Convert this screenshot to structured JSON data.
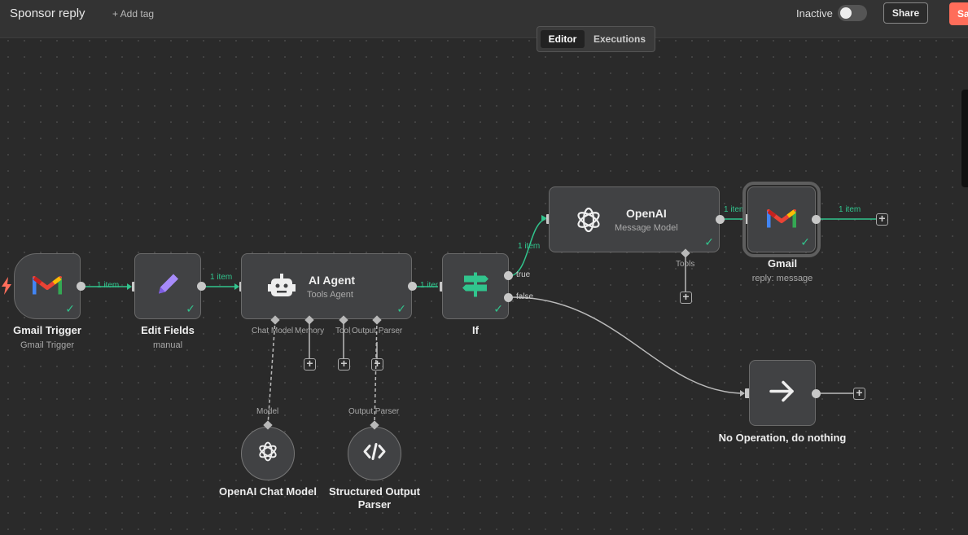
{
  "header": {
    "workflow_name": "Sponsor reply",
    "add_tag": "+ Add tag",
    "status_label": "Inactive",
    "share_label": "Share",
    "save_label": "Sa"
  },
  "view_tabs": [
    {
      "label": "Editor",
      "active": true
    },
    {
      "label": "Executions",
      "active": false
    }
  ],
  "nodes": {
    "gmail_trigger": {
      "title": "Gmail Trigger",
      "subtitle": "Gmail Trigger"
    },
    "edit_fields": {
      "title": "Edit Fields",
      "subtitle": "manual"
    },
    "ai_agent": {
      "title": "AI Agent",
      "subtitle": "Tools Agent",
      "ports": [
        "Chat Model",
        "Memory",
        "Tool",
        "Output Parser"
      ]
    },
    "if": {
      "title": "If",
      "true_label": "true",
      "false_label": "false"
    },
    "openai": {
      "title": "OpenAI",
      "subtitle": "Message Model",
      "tools_label": "Tools"
    },
    "gmail": {
      "title": "Gmail",
      "subtitle": "reply: message"
    },
    "no_op": {
      "title": "No Operation, do nothing"
    },
    "openai_chat_model": {
      "title": "OpenAI Chat Model",
      "port_label": "Model"
    },
    "structured_output_parser": {
      "title": "Structured Output Parser",
      "port_label": "Output Parser"
    }
  },
  "connections": {
    "trigger_to_edit": "1 item",
    "edit_to_agent": "1 item",
    "agent_to_if": "1 item",
    "if_to_openai": "1 item",
    "openai_to_gmail": "1 item",
    "gmail_out": "1 item"
  },
  "colors": {
    "canvas": "#2a2a2a",
    "node": "#414244",
    "success": "#31c48d",
    "accent": "#ff6d5a"
  }
}
